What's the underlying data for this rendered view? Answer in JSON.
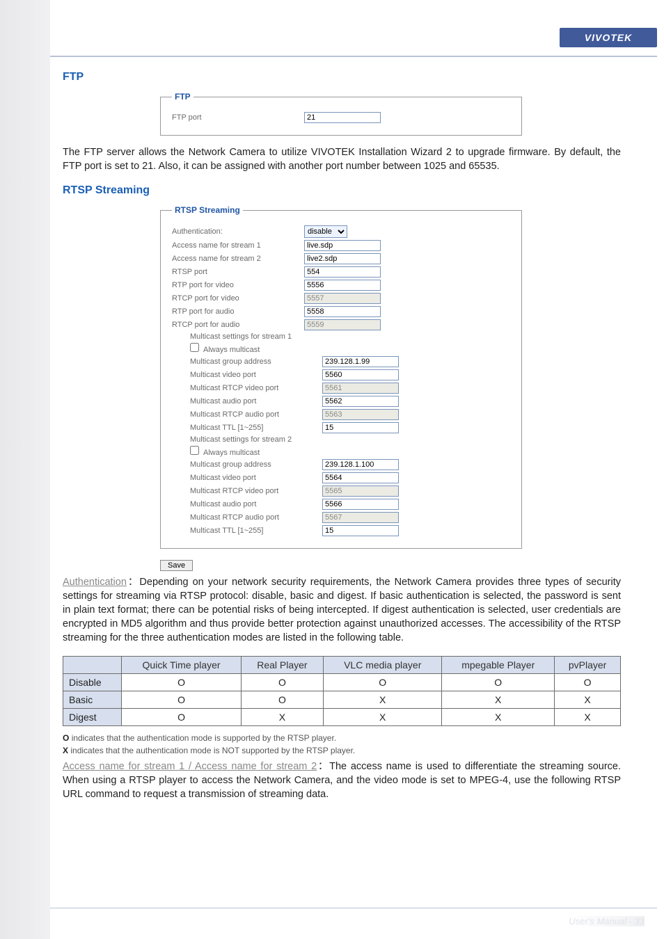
{
  "header": {
    "brand": "VIVOTEK"
  },
  "ftp": {
    "heading": "FTP",
    "legend": "FTP",
    "port_label": "FTP port",
    "port_value": "21",
    "paragraph": "The FTP server allows the Network Camera to utilize VIVOTEK Installation Wizard 2 to upgrade firmware. By default, the FTP port is set to 21. Also, it can be assigned with another port number between 1025 and 65535."
  },
  "rtsp": {
    "heading": "RTSP Streaming",
    "legend": "RTSP Streaming",
    "auth_label": "Authentication:",
    "auth_value": "disable",
    "access1_label": "Access name for stream 1",
    "access1_value": "live.sdp",
    "access2_label": "Access name for stream 2",
    "access2_value": "live2.sdp",
    "rtsp_port_label": "RTSP port",
    "rtsp_port_value": "554",
    "rtp_video_label": "RTP port for video",
    "rtp_video_value": "5556",
    "rtcp_video_label": "RTCP port for video",
    "rtcp_video_value": "5557",
    "rtp_audio_label": "RTP port for audio",
    "rtp_audio_value": "5558",
    "rtcp_audio_label": "RTCP port for audio",
    "rtcp_audio_value": "5559",
    "mc1": {
      "heading": "Multicast settings for stream 1",
      "always": "Always multicast",
      "group_label": "Multicast group address",
      "group_value": "239.128.1.99",
      "vport_label": "Multicast video port",
      "vport_value": "5560",
      "rtcpv_label": "Multicast RTCP video port",
      "rtcpv_value": "5561",
      "aport_label": "Multicast audio port",
      "aport_value": "5562",
      "rtcpa_label": "Multicast RTCP audio port",
      "rtcpa_value": "5563",
      "ttl_label": "Multicast TTL [1~255]",
      "ttl_value": "15"
    },
    "mc2": {
      "heading": "Multicast settings for stream 2",
      "always": "Always multicast",
      "group_label": "Multicast group address",
      "group_value": "239.128.1.100",
      "vport_label": "Multicast video port",
      "vport_value": "5564",
      "rtcpv_label": "Multicast RTCP video port",
      "rtcpv_value": "5565",
      "aport_label": "Multicast audio port",
      "aport_value": "5566",
      "rtcpa_label": "Multicast RTCP audio port",
      "rtcpa_value": "5567",
      "ttl_label": "Multicast TTL [1~255]",
      "ttl_value": "15"
    },
    "save_label": "Save"
  },
  "auth_para": {
    "underline": "Authentication",
    "colon": "：",
    "text": "Depending on your network security requirements, the Network Camera provides three types of security settings for streaming via RTSP protocol: disable, basic and digest. If basic authentication is selected, the password is sent in plain text format; there can be potential risks of being intercepted. If digest authentication is selected, user credentials are encrypted in MD5 algorithm and thus provide better protection against unauthorized accesses. The accessibility of the RTSP streaming for the three authentication modes are listed in the following table."
  },
  "table": {
    "cols": [
      "Quick Time player",
      "Real Player",
      "VLC media player",
      "mpegable Player",
      "pvPlayer"
    ],
    "rows": [
      {
        "name": "Disable",
        "v": [
          "O",
          "O",
          "O",
          "O",
          "O"
        ]
      },
      {
        "name": "Basic",
        "v": [
          "O",
          "O",
          "X",
          "X",
          "X"
        ]
      },
      {
        "name": "Digest",
        "v": [
          "O",
          "X",
          "X",
          "X",
          "X"
        ]
      }
    ]
  },
  "notes": {
    "o_sym": "O",
    "o_text": "indicates that the authentication mode is supported by the RTSP player.",
    "x_sym": "X",
    "x_text": "indicates that the authentication mode is NOT supported by the RTSP player."
  },
  "access_para": {
    "underline": "Access name for stream 1 / Access name for stream 2",
    "colon": "：",
    "text": "The access name is used to differentiate the streaming source. When using a RTSP player to access the Network Camera, and the video mode is set to MPEG-4, use the following RTSP URL command to request a transmission of streaming data."
  },
  "footer": {
    "text": "User's Manual - 33"
  }
}
